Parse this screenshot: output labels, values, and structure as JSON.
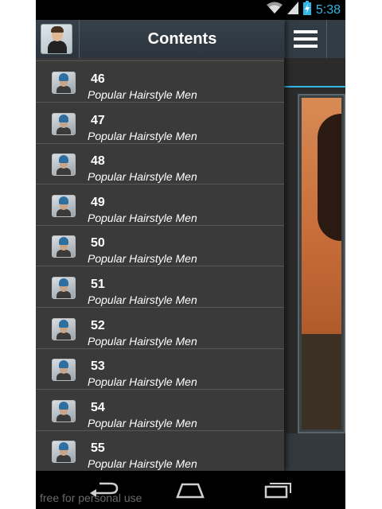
{
  "status_bar": {
    "time": "5:38",
    "icons": [
      "wifi-icon",
      "signal-icon",
      "battery-charging-icon"
    ],
    "clock_color": "#33b5e5"
  },
  "drawer": {
    "title": "Contents",
    "app_icon": "app-icon",
    "items": [
      {
        "number": "46",
        "label": "Popular Hairstyle Men"
      },
      {
        "number": "47",
        "label": "Popular Hairstyle Men"
      },
      {
        "number": "48",
        "label": "Popular Hairstyle Men"
      },
      {
        "number": "49",
        "label": "Popular Hairstyle Men"
      },
      {
        "number": "50",
        "label": "Popular Hairstyle Men"
      },
      {
        "number": "51",
        "label": "Popular Hairstyle Men"
      },
      {
        "number": "52",
        "label": "Popular Hairstyle Men"
      },
      {
        "number": "53",
        "label": "Popular Hairstyle Men"
      },
      {
        "number": "54",
        "label": "Popular Hairstyle Men"
      },
      {
        "number": "55",
        "label": "Popular Hairstyle Men"
      }
    ]
  },
  "main": {
    "menu_icon": "hamburger-menu-icon",
    "accent_color": "#33b5e5"
  },
  "nav_bar": {
    "buttons": [
      "back-icon",
      "home-icon",
      "recent-apps-icon"
    ]
  },
  "watermark": "free for personal use"
}
